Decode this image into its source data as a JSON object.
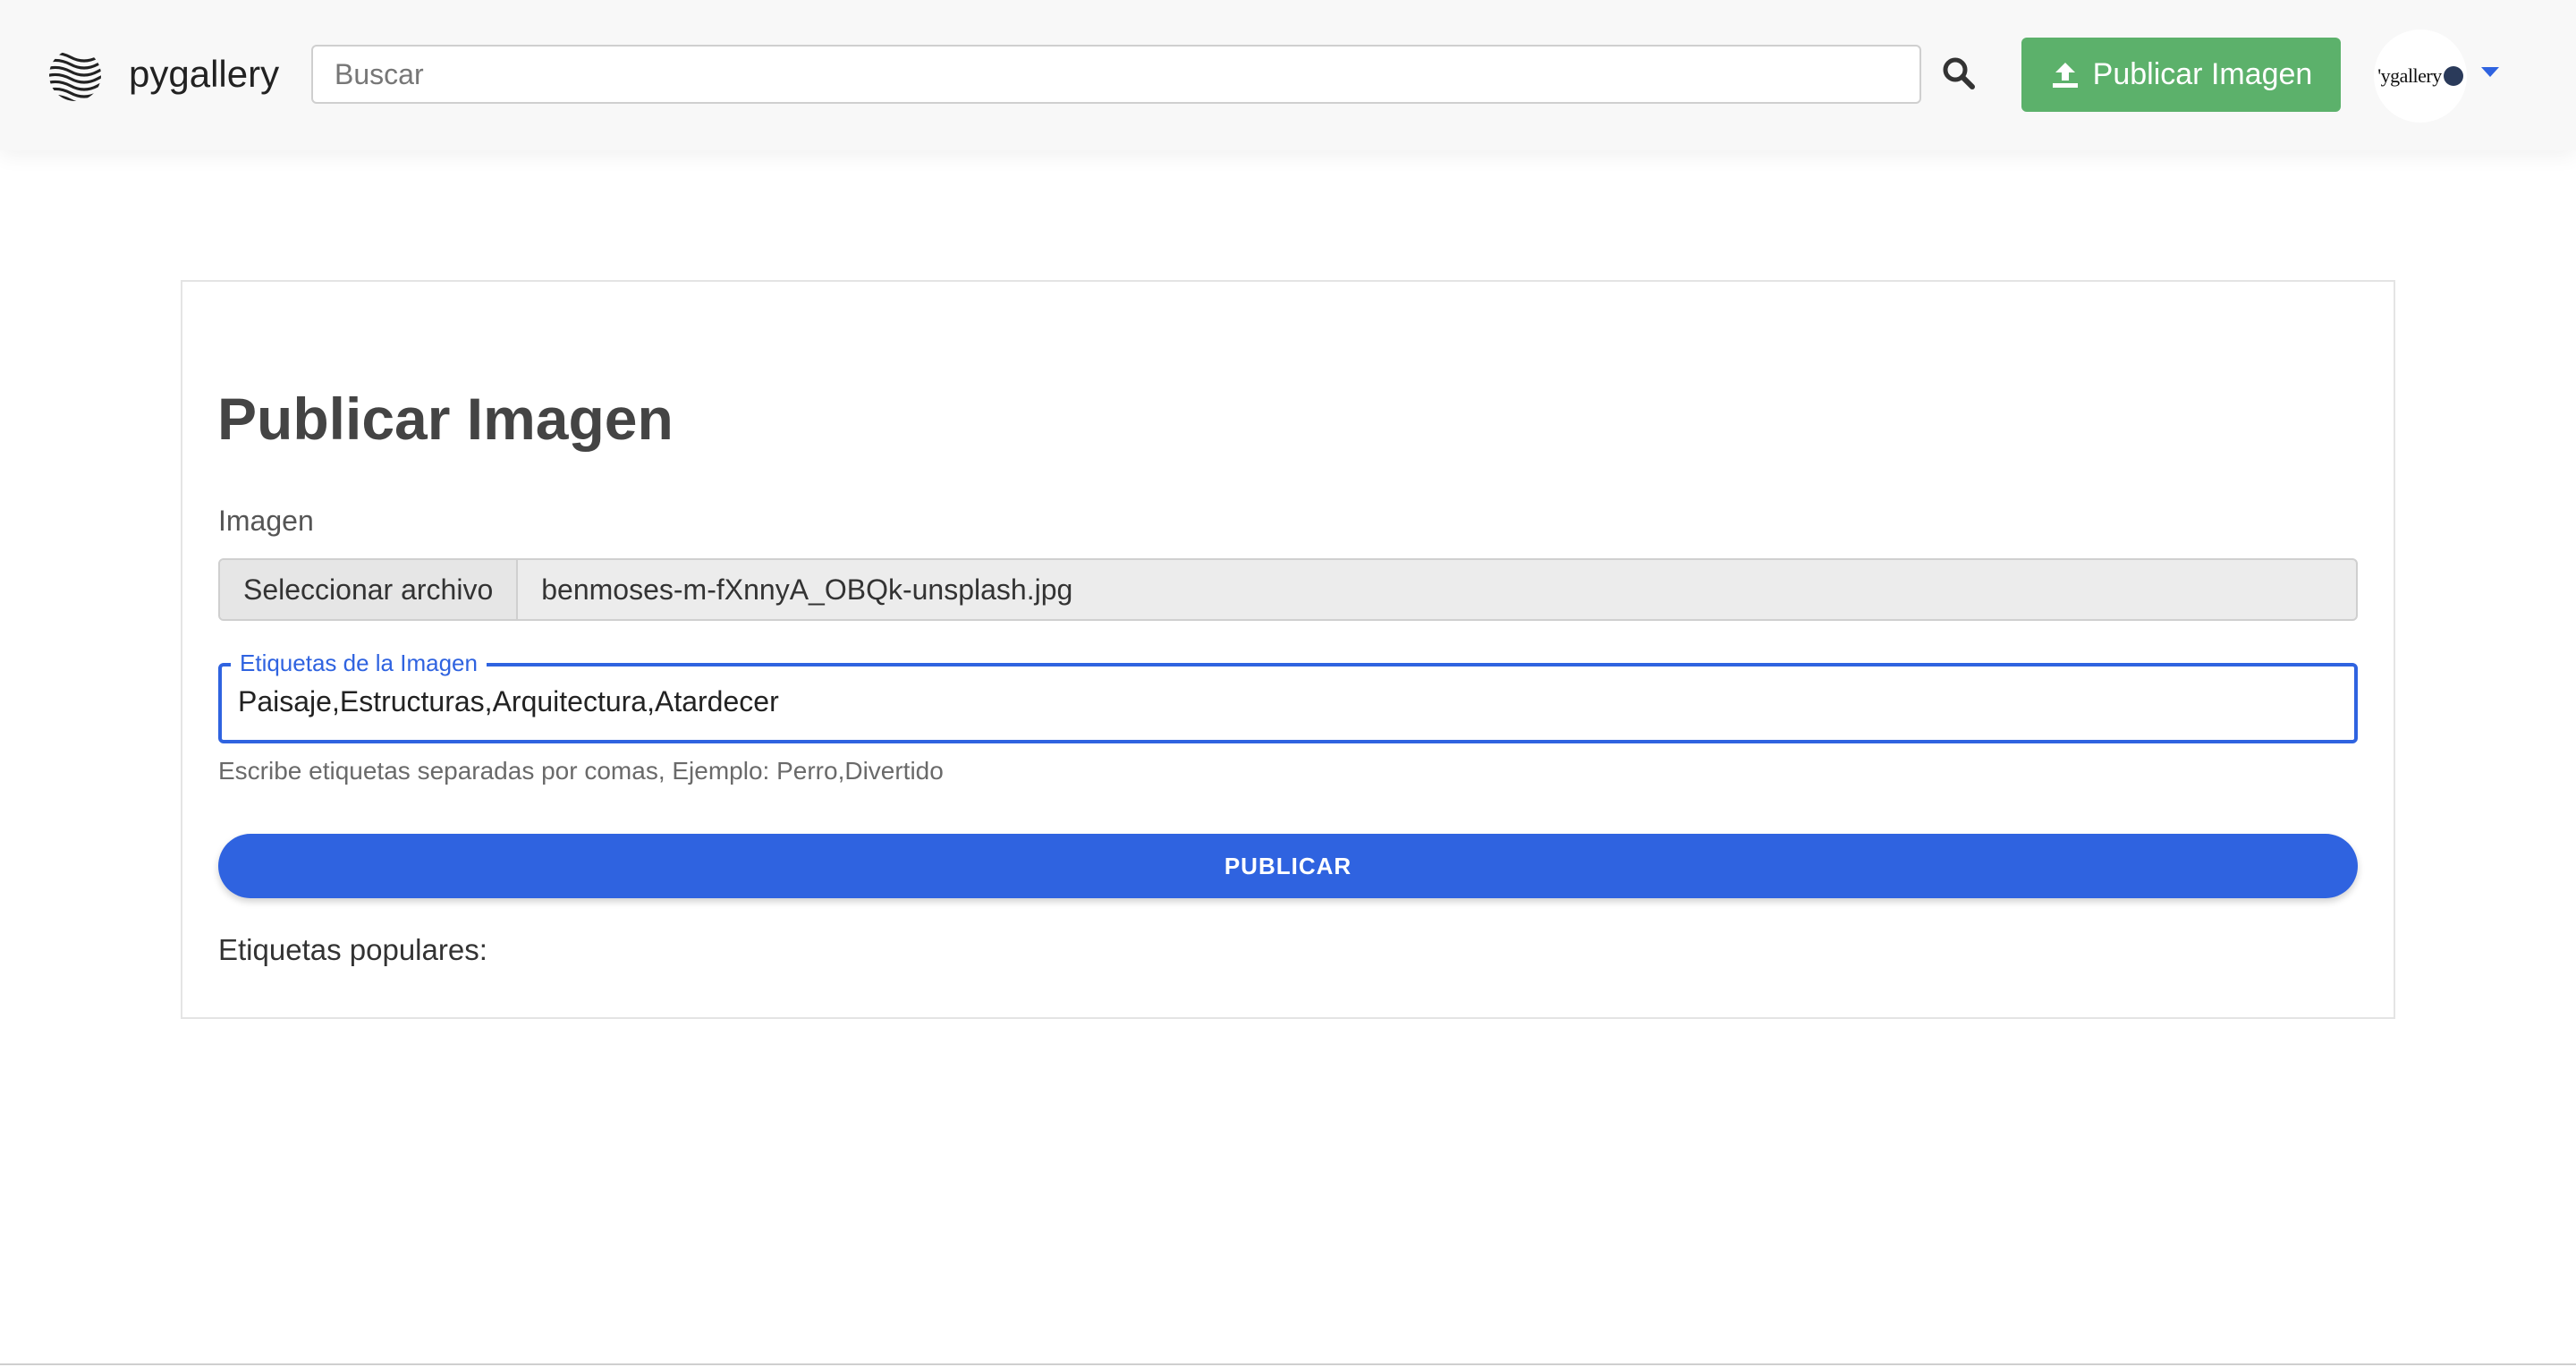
{
  "header": {
    "brand": "pygallery",
    "search": {
      "placeholder": "Buscar",
      "value": ""
    },
    "publish_button": "Publicar Imagen",
    "avatar_text": "'ygallery",
    "icons": {
      "logo": "waves-logo-icon",
      "search": "search-icon",
      "upload": "upload-icon",
      "caret": "caret-down-icon"
    }
  },
  "form": {
    "title": "Publicar Imagen",
    "image_label": "Imagen",
    "file_button": "Seleccionar archivo",
    "file_name": "benmoses-m-fXnnyA_OBQk-unsplash.jpg",
    "tags_label": "Etiquetas de la Imagen",
    "tags_value": "Paisaje,Estructuras,Arquitectura,Atardecer",
    "helper": "Escribe etiquetas separadas por comas, Ejemplo: Perro,Divertido",
    "submit": "PUBLICAR",
    "popular_label": "Etiquetas populares:"
  },
  "colors": {
    "navbar_bg": "#f8f8f8",
    "publish_green": "#5cb16b",
    "primary_blue": "#2f63e0",
    "file_bg": "#ececec"
  }
}
